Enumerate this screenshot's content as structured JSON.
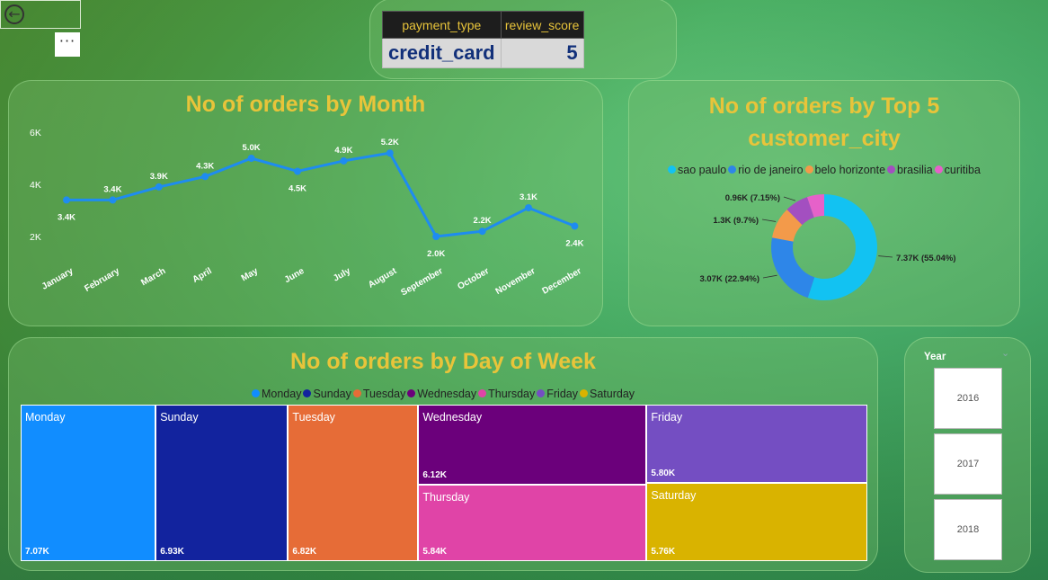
{
  "card": {
    "headers": [
      "payment_type",
      "review_score"
    ],
    "values": [
      "credit_card",
      "5"
    ]
  },
  "toolbar": {
    "more_label": "···"
  },
  "month_chart": {
    "title": "No of orders by Month"
  },
  "city_chart": {
    "title_line1": "No of orders by Top 5",
    "title_line2": "customer_city"
  },
  "day_chart": {
    "title": "No of orders by Day of Week"
  },
  "slicer": {
    "title": "Year",
    "options": [
      "2016",
      "2017",
      "2018"
    ]
  },
  "colors": {
    "title": "#e8c43a",
    "line": "#1e8cf0"
  },
  "chart_data": [
    {
      "type": "line",
      "title": "No of orders by Month",
      "categories": [
        "January",
        "February",
        "March",
        "April",
        "May",
        "June",
        "July",
        "August",
        "September",
        "October",
        "November",
        "December"
      ],
      "values": [
        3.4,
        3.4,
        3.9,
        4.3,
        5.0,
        4.5,
        4.9,
        5.2,
        2.0,
        2.2,
        3.1,
        2.4
      ],
      "data_labels": [
        "3.4K",
        "3.4K",
        "3.9K",
        "4.3K",
        "5.0K",
        "4.5K",
        "4.9K",
        "5.2K",
        "2.0K",
        "2.2K",
        "3.1K",
        "2.4K"
      ],
      "yticks": [
        "2K",
        "4K",
        "6K"
      ],
      "ylim": [
        2,
        6
      ],
      "unit": "K"
    },
    {
      "type": "pie",
      "title": "No of orders by Top 5 customer_city",
      "legend_position": "top",
      "categories": [
        "sao paulo",
        "rio de janeiro",
        "belo horizonte",
        "brasilia",
        "curitiba"
      ],
      "values": [
        7.37,
        3.07,
        1.3,
        0.96,
        0.7
      ],
      "data_labels": [
        "7.37K (55.04%)",
        "3.07K (22.94%)",
        "1.3K (9.7%)",
        "0.96K (7.15%)",
        ""
      ],
      "colors": [
        "#12c2f2",
        "#2e86e8",
        "#f39a4a",
        "#a34fc0",
        "#e661c9"
      ]
    },
    {
      "type": "treemap",
      "title": "No of orders by Day of Week",
      "legend_position": "top",
      "categories": [
        "Monday",
        "Sunday",
        "Tuesday",
        "Wednesday",
        "Thursday",
        "Friday",
        "Saturday"
      ],
      "values": [
        7.07,
        6.93,
        6.82,
        6.12,
        5.84,
        5.8,
        5.76
      ],
      "data_labels": [
        "7.07K",
        "6.93K",
        "6.82K",
        "6.12K",
        "5.84K",
        "5.80K",
        "5.76K"
      ],
      "colors": [
        "#118dff",
        "#12239e",
        "#e66c37",
        "#6b007b",
        "#e044a7",
        "#744ec2",
        "#d9b300"
      ]
    }
  ]
}
